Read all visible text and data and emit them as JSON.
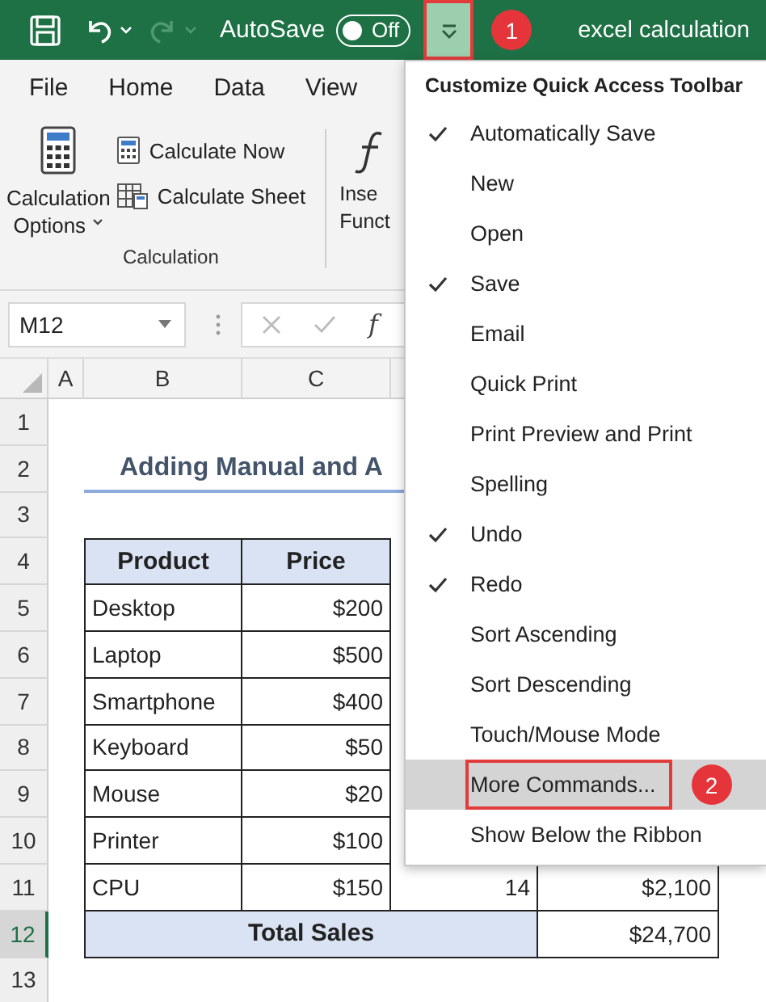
{
  "title_bar": {
    "autosave_label": "AutoSave",
    "autosave": {
      "on": false,
      "label": "Off"
    },
    "redo_disabled": true,
    "qat_button": {
      "highlighted": true,
      "callout": "1"
    },
    "title": "excel calculation"
  },
  "ribbon": {
    "tabs": [
      {
        "label": "File"
      },
      {
        "label": "Home"
      },
      {
        "label": "Data"
      },
      {
        "label": "View"
      }
    ],
    "calc_options": {
      "line1": "Calculation",
      "line2": "Options"
    },
    "commands": [
      {
        "kind": "now",
        "label": "Calculate Now"
      },
      {
        "kind": "sheet",
        "label": "Calculate Sheet"
      }
    ],
    "group_label": "Calculation",
    "cut_command": {
      "line1": "Inse",
      "line2": "Funct"
    }
  },
  "formula_bar": {
    "name_box": "M12",
    "fx_label": "f"
  },
  "sheet": {
    "columns": [
      "A",
      "B",
      "C"
    ],
    "row_headers": [
      {
        "label": "1",
        "selected": false
      },
      {
        "label": "2",
        "selected": false
      },
      {
        "label": "3",
        "selected": false
      },
      {
        "label": "4",
        "selected": false
      },
      {
        "label": "5",
        "selected": false
      },
      {
        "label": "6",
        "selected": false
      },
      {
        "label": "7",
        "selected": false
      },
      {
        "label": "8",
        "selected": false
      },
      {
        "label": "9",
        "selected": false
      },
      {
        "label": "10",
        "selected": false
      },
      {
        "label": "11",
        "selected": false
      },
      {
        "label": "12",
        "selected": true
      },
      {
        "label": "13",
        "selected": false
      }
    ],
    "title": "Adding Manual and A",
    "table_header": [
      "Product",
      "Price"
    ],
    "items": [
      {
        "product": "Desktop",
        "price": "$200"
      },
      {
        "product": "Laptop",
        "price": "$500"
      },
      {
        "product": "Smartphone",
        "price": "$400"
      },
      {
        "product": "Keyboard",
        "price": "$50"
      },
      {
        "product": "Mouse",
        "price": "$20"
      },
      {
        "product": "Printer",
        "price": "$100"
      },
      {
        "product": "CPU",
        "price": "$150",
        "quantity": "14",
        "total": "$2,100"
      }
    ],
    "total": {
      "label": "Total Sales",
      "value": "$24,700"
    }
  },
  "menu": {
    "title": "Customize Quick Access Toolbar",
    "items": [
      {
        "label": "Automatically Save",
        "checked": true,
        "highlighted": false
      },
      {
        "label": "New",
        "checked": false,
        "highlighted": false
      },
      {
        "label": "Open",
        "checked": false,
        "highlighted": false
      },
      {
        "label": "Save",
        "checked": true,
        "highlighted": false
      },
      {
        "label": "Email",
        "checked": false,
        "highlighted": false
      },
      {
        "label": "Quick Print",
        "checked": false,
        "highlighted": false
      },
      {
        "label": "Print Preview and Print",
        "checked": false,
        "highlighted": false
      },
      {
        "label": "Spelling",
        "checked": false,
        "highlighted": false
      },
      {
        "label": "Undo",
        "checked": true,
        "highlighted": false
      },
      {
        "label": "Redo",
        "checked": true,
        "highlighted": false
      },
      {
        "label": "Sort Ascending",
        "checked": false,
        "highlighted": false
      },
      {
        "label": "Sort Descending",
        "checked": false,
        "highlighted": false
      },
      {
        "label": "Touch/Mouse Mode",
        "checked": false,
        "highlighted": false
      },
      {
        "label": "More Commands...",
        "checked": false,
        "highlighted": true,
        "callout": "2"
      },
      {
        "label": "Show Below the Ribbon",
        "checked": false,
        "highlighted": false
      }
    ]
  }
}
